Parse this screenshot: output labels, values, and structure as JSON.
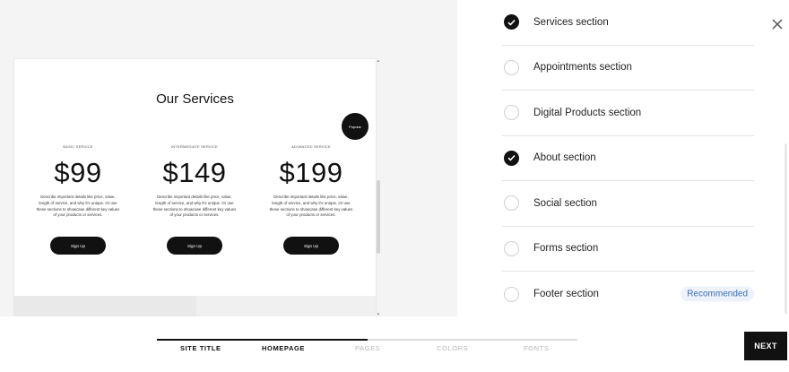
{
  "preview": {
    "heading": "Our Services",
    "popular_badge": "Popular",
    "plans": [
      {
        "label": "Basic Service",
        "price": "$99",
        "description": "Describe important details like price, value, length of service, and why it's unique. Or use these sections to showcase different key values of your products or services.",
        "button": "Sign Up"
      },
      {
        "label": "Intermediate Service",
        "price": "$149",
        "description": "Describe important details like price, value, length of service, and why it's unique. Or use these sections to showcase different key values of your products or services.",
        "button": "Sign Up"
      },
      {
        "label": "Advanced Service",
        "price": "$199",
        "description": "Describe important details like price, value, length of service, and why it's unique. Or use these sections to showcase different key values of your products or services.",
        "button": "Sign Up"
      }
    ]
  },
  "panel": {
    "close_icon": "close-icon",
    "sections": [
      {
        "label": "Services section",
        "checked": true,
        "badge": ""
      },
      {
        "label": "Appointments section",
        "checked": false,
        "badge": ""
      },
      {
        "label": "Digital Products section",
        "checked": false,
        "badge": ""
      },
      {
        "label": "About section",
        "checked": true,
        "badge": ""
      },
      {
        "label": "Social section",
        "checked": false,
        "badge": ""
      },
      {
        "label": "Forms section",
        "checked": false,
        "badge": ""
      },
      {
        "label": "Footer section",
        "checked": false,
        "badge": "Recommended"
      }
    ]
  },
  "footer": {
    "steps": [
      {
        "label": "Site Title",
        "state": "done"
      },
      {
        "label": "Homepage",
        "state": "current"
      },
      {
        "label": "Pages",
        "state": "future"
      },
      {
        "label": "Colors",
        "state": "future"
      },
      {
        "label": "Fonts",
        "state": "future"
      }
    ],
    "progress": 0.5,
    "next_label": "NEXT"
  },
  "colors": {
    "accent": "#111111",
    "badge_bg": "#eef3fb",
    "badge_text": "#3c6cb4",
    "muted_step": "#b5b5b5"
  }
}
